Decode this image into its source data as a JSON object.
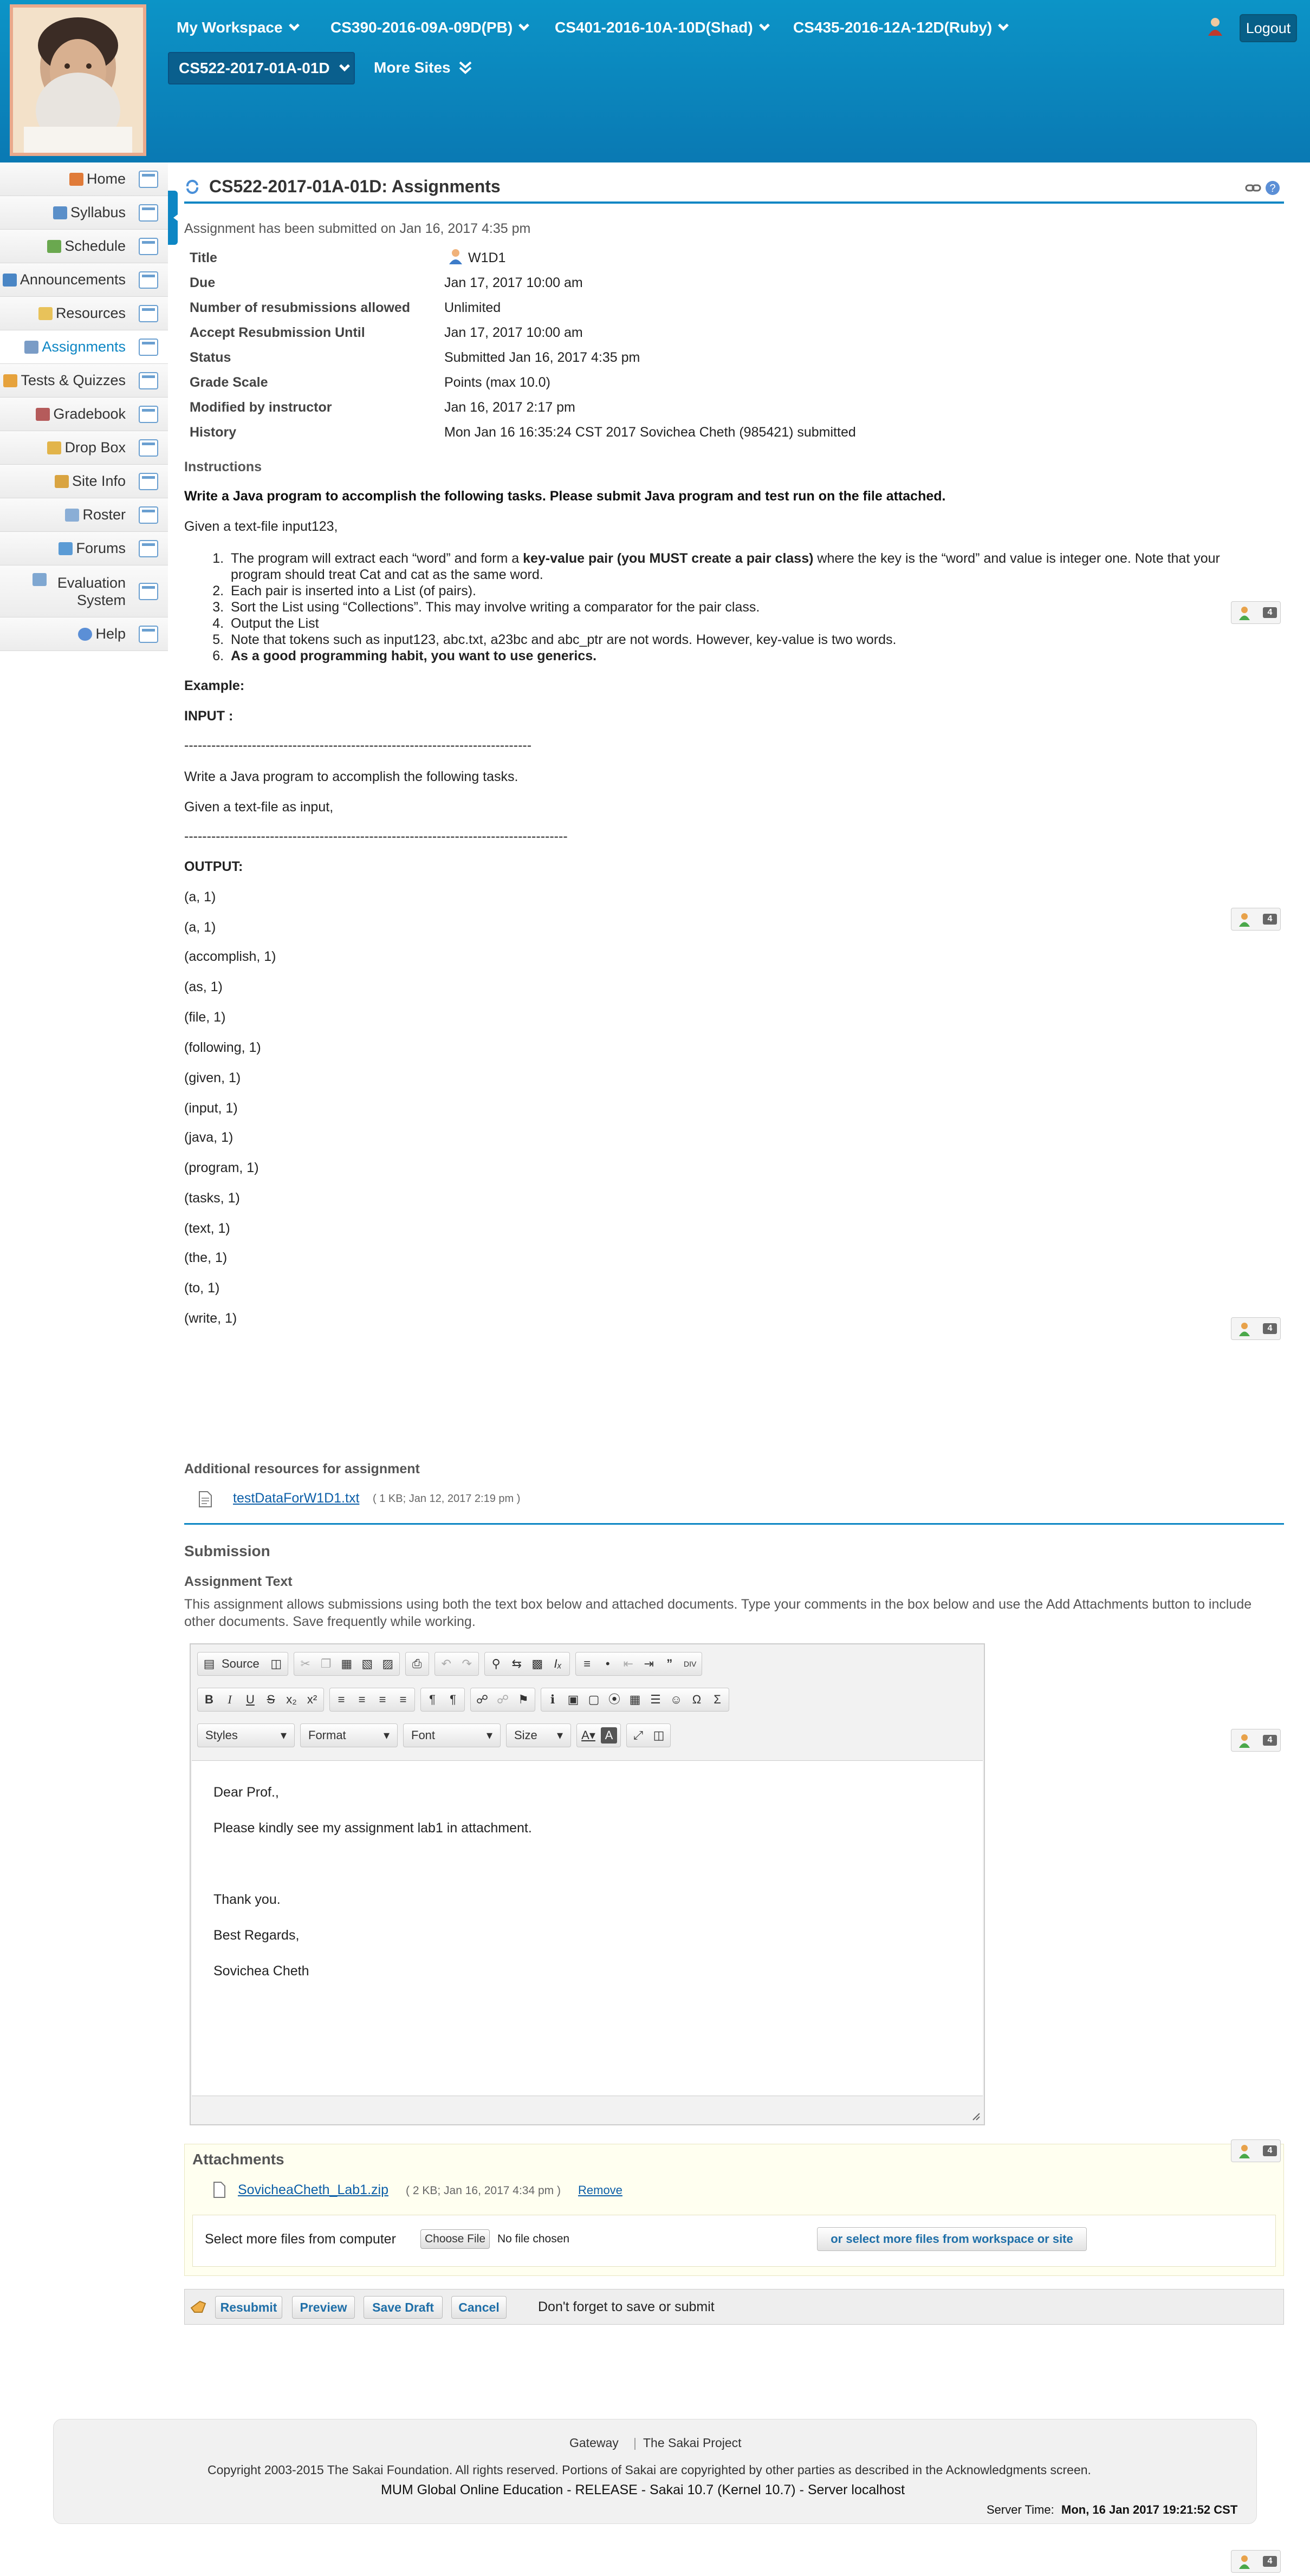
{
  "topnav": {
    "sites": [
      {
        "label": "My Workspace"
      },
      {
        "label": "CS390-2016-09A-09D(PB)"
      },
      {
        "label": "CS401-2016-10A-10D(Shad)"
      },
      {
        "label": "CS435-2016-12A-12D(Ruby)"
      }
    ],
    "current_site": "CS522-2017-01A-01D",
    "more_sites": "More Sites",
    "logout": "Logout",
    "accent": "#0a86c0"
  },
  "sidebar": {
    "items": [
      {
        "label": "Home",
        "icon": "home-icon"
      },
      {
        "label": "Syllabus",
        "icon": "syllabus-icon"
      },
      {
        "label": "Schedule",
        "icon": "calendar-icon"
      },
      {
        "label": "Announcements",
        "icon": "megaphone-icon"
      },
      {
        "label": "Resources",
        "icon": "folder-icon"
      },
      {
        "label": "Assignments",
        "icon": "assignment-icon"
      },
      {
        "label": "Tests & Quizzes",
        "icon": "pencil-icon"
      },
      {
        "label": "Gradebook",
        "icon": "gradebook-icon"
      },
      {
        "label": "Drop Box",
        "icon": "dropbox-icon"
      },
      {
        "label": "Site Info",
        "icon": "siteinfo-icon"
      },
      {
        "label": "Roster",
        "icon": "roster-icon"
      },
      {
        "label": "Forums",
        "icon": "forums-icon"
      },
      {
        "label": "Evaluation System",
        "icon": "evaluation-icon"
      },
      {
        "label": "Help",
        "icon": "help-icon"
      }
    ]
  },
  "page": {
    "title": "CS522-2017-01A-01D: Assignments",
    "submitted_notice": "Assignment has been submitted on Jan 16, 2017 4:35 pm"
  },
  "details": [
    {
      "label": "Title",
      "value": "W1D1"
    },
    {
      "label": "Due",
      "value": "Jan 17, 2017 10:00 am"
    },
    {
      "label": "Number of resubmissions allowed",
      "value": "Unlimited"
    },
    {
      "label": "Accept Resubmission Until",
      "value": "Jan 17, 2017 10:00 am"
    },
    {
      "label": "Status",
      "value": "Submitted Jan 16, 2017 4:35 pm"
    },
    {
      "label": "Grade Scale",
      "value": "Points (max 10.0)"
    },
    {
      "label": "Modified by instructor",
      "value": "Jan 16, 2017 2:17 pm"
    },
    {
      "label": "History",
      "value": "Mon Jan 16 16:35:24 CST 2017 Sovichea Cheth (985421) submitted"
    }
  ],
  "instructions": {
    "heading": "Instructions",
    "intro_bold": "Write a Java program to accomplish the following tasks. Please submit Java program and test run on the file attached.",
    "given": "Given a text-file input123,",
    "list": [
      {
        "pre": "The program will extract each “word” and form a ",
        "bold": "key-value pair (you MUST create a pair class)",
        "post": " where the key is the “word” and value is integer one.  Note that your program should treat Cat and cat as the same word."
      },
      {
        "pre": "Each pair is inserted into a List (of pairs).",
        "bold": "",
        "post": ""
      },
      {
        "pre": "Sort the List using “Collections”. This may involve writing a comparator for the pair class.",
        "bold": "",
        "post": ""
      },
      {
        "pre": "Output the List",
        "bold": "",
        "post": ""
      },
      {
        "pre": "Note that tokens such as input123, abc.txt,  a23bc and abc_ptr  are not words. However, key-value is two words.",
        "bold": "",
        "post": ""
      },
      {
        "pre": "",
        "bold": "As a good programming habit, you want to use generics.",
        "post": ""
      }
    ],
    "example": "Example:",
    "input_label": "INPUT :",
    "dash1": "-----------------------------------------------------------------------------",
    "input_line1": "Write a Java program to accomplish the following tasks.",
    "input_line2": "Given a text-file as input,",
    "dash2": "-------------------------------------------------------------------------------------",
    "output_label": "OUTPUT:",
    "output": [
      "(a, 1)",
      "(a, 1)",
      "(accomplish, 1)",
      "(as, 1)",
      "(file, 1)",
      "(following, 1)",
      "(given, 1)",
      "(input, 1)",
      "(java, 1)",
      "(program, 1)",
      "(tasks, 1)",
      "(text, 1)",
      "(the, 1)",
      "(to, 1)",
      "(write, 1)"
    ]
  },
  "resources": {
    "heading": "Additional resources for assignment",
    "file_name": "testDataForW1D1.txt",
    "file_meta": "( 1 KB; Jan 12, 2017 2:19 pm )"
  },
  "submission": {
    "heading": "Submission",
    "text_heading": "Assignment Text",
    "help": "This assignment allows submissions using both the text box below and attached documents. Type your comments in the box below and use the Add Attachments button to include other documents. Save frequently while working.",
    "toolbar": {
      "source": "Source",
      "styles": "Styles",
      "format": "Format",
      "font": "Font",
      "size": "Size"
    },
    "body": [
      "Dear Prof.,",
      "Please kindly see my assignment lab1 in attachment.",
      "Thank you.",
      "Best Regards,",
      "Sovichea Cheth"
    ]
  },
  "attachments": {
    "heading": "Attachments",
    "file_name": "SovicheaCheth_Lab1.zip",
    "file_meta": "( 2 KB; Jan 16, 2017 4:34 pm )",
    "remove": "Remove",
    "select_label": "Select more files from computer",
    "choose_file": "Choose File",
    "no_file": "No file chosen",
    "workspace_button": "or select more files from workspace or site"
  },
  "actions": {
    "resubmit": "Resubmit",
    "preview": "Preview",
    "save_draft": "Save Draft",
    "cancel": "Cancel",
    "reminder": "Don't forget to save or submit"
  },
  "presence_count": "4",
  "footer": {
    "gateway": "Gateway",
    "sakai_project": "The Sakai Project",
    "copyright": "Copyright 2003-2015 The Sakai Foundation. All rights reserved. Portions of Sakai are copyrighted by other parties as described in the Acknowledgments screen.",
    "release": "MUM Global Online Education - RELEASE - Sakai 10.7 (Kernel 10.7) - Server localhost",
    "server_time_label": "Server Time:",
    "server_time": "Mon, 16 Jan 2017 19:21:52 CST"
  }
}
